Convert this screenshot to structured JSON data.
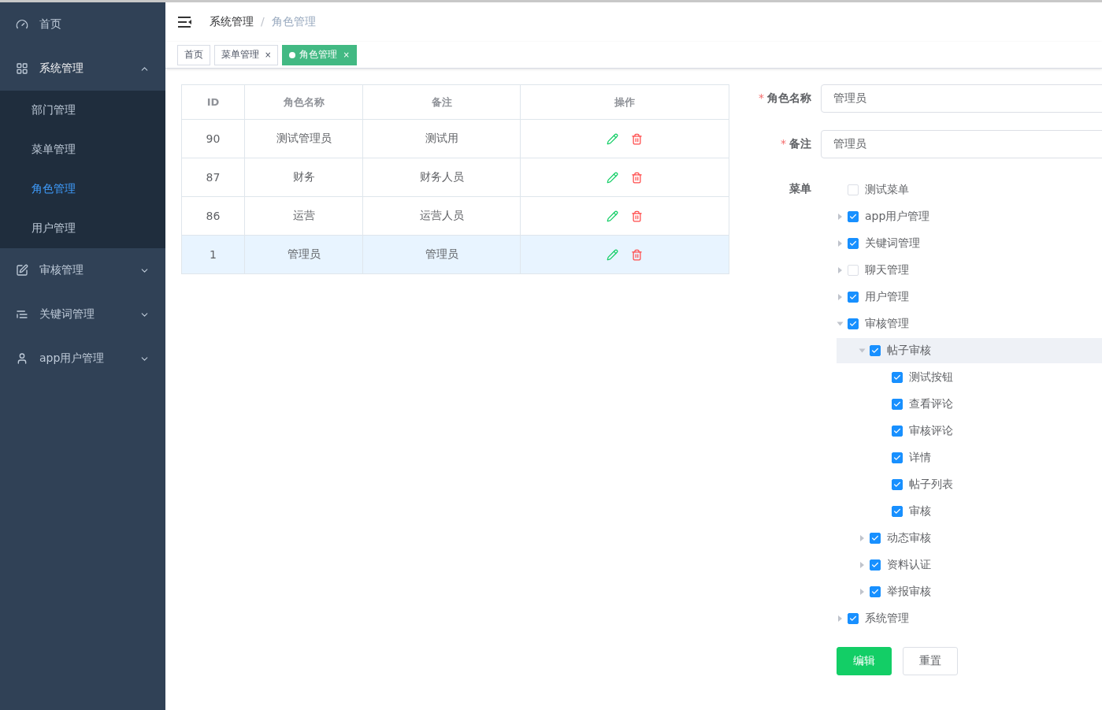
{
  "sidebar": {
    "items": [
      {
        "label": "首页",
        "expanded": false
      },
      {
        "label": "系统管理",
        "expanded": true,
        "children": [
          {
            "label": "部门管理",
            "selected": false
          },
          {
            "label": "菜单管理",
            "selected": false
          },
          {
            "label": "角色管理",
            "selected": true
          },
          {
            "label": "用户管理",
            "selected": false
          }
        ]
      },
      {
        "label": "审核管理",
        "expanded": false
      },
      {
        "label": "关键词管理",
        "expanded": false
      },
      {
        "label": "app用户管理",
        "expanded": false
      }
    ]
  },
  "breadcrumb": [
    "系统管理",
    "角色管理"
  ],
  "breadcrumb_separator": "/",
  "tags": [
    {
      "label": "首页",
      "selected": false,
      "closable": false
    },
    {
      "label": "菜单管理",
      "selected": false,
      "closable": true
    },
    {
      "label": "角色管理",
      "selected": true,
      "closable": true
    }
  ],
  "close_glyph": "×",
  "table": {
    "columns": [
      "ID",
      "角色名称",
      "备注",
      "操作"
    ],
    "rows": [
      {
        "id": "90",
        "name": "测试管理员",
        "note": "测试用",
        "selected": false
      },
      {
        "id": "87",
        "name": "财务",
        "note": "财务人员",
        "selected": false
      },
      {
        "id": "86",
        "name": "运营",
        "note": "运营人员",
        "selected": false
      },
      {
        "id": "1",
        "name": "管理员",
        "note": "管理员",
        "selected": true
      }
    ]
  },
  "form": {
    "fields": [
      {
        "label": "角色名称",
        "required": true,
        "value": "管理员"
      },
      {
        "label": "备注",
        "required": true,
        "value": "管理员"
      }
    ],
    "required_mark": "*",
    "menu_label": "菜单",
    "tree": [
      {
        "label": "测试菜单",
        "checked": false,
        "highlighted": false
      },
      {
        "label": "app用户管理",
        "checked": true,
        "highlighted": false,
        "expanded": false
      },
      {
        "label": "关键词管理",
        "checked": true,
        "highlighted": false,
        "expanded": false
      },
      {
        "label": "聊天管理",
        "checked": false,
        "highlighted": false,
        "expanded": false
      },
      {
        "label": "用户管理",
        "checked": true,
        "highlighted": false,
        "expanded": false
      },
      {
        "label": "审核管理",
        "checked": true,
        "highlighted": false,
        "expanded": true,
        "children": [
          {
            "label": "帖子审核",
            "checked": true,
            "highlighted": true,
            "expanded": true,
            "children": [
              {
                "label": "测试按钮",
                "checked": true,
                "highlighted": false
              },
              {
                "label": "查看评论",
                "checked": true,
                "highlighted": false
              },
              {
                "label": "审核评论",
                "checked": true,
                "highlighted": false
              },
              {
                "label": "详情",
                "checked": true,
                "highlighted": false
              },
              {
                "label": "帖子列表",
                "checked": true,
                "highlighted": false
              },
              {
                "label": "审核",
                "checked": true,
                "highlighted": false
              }
            ]
          },
          {
            "label": "动态审核",
            "checked": true,
            "highlighted": false,
            "expanded": false
          },
          {
            "label": "资料认证",
            "checked": true,
            "highlighted": false,
            "expanded": false
          },
          {
            "label": "举报审核",
            "checked": true,
            "highlighted": false,
            "expanded": false
          }
        ]
      },
      {
        "label": "系统管理",
        "checked": true,
        "highlighted": false,
        "expanded": false
      }
    ],
    "buttons": [
      {
        "label": "编辑",
        "kind": "primary"
      },
      {
        "label": "重置",
        "kind": "default"
      }
    ]
  }
}
